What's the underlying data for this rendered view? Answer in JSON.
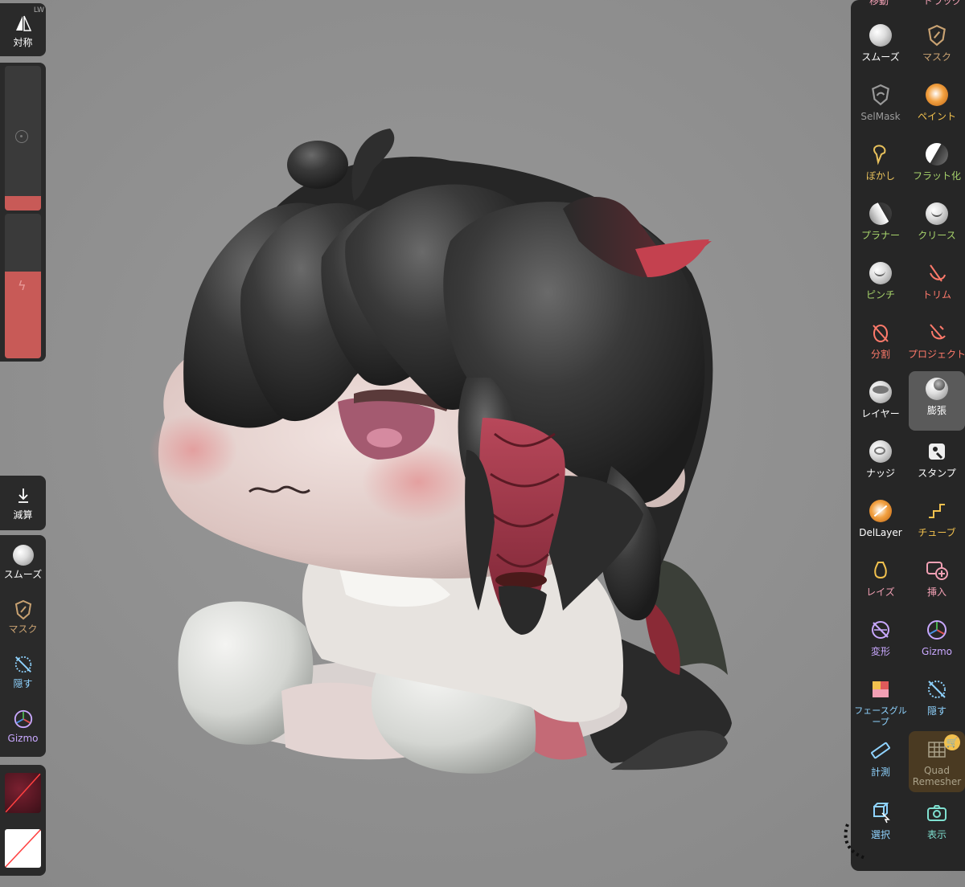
{
  "left_toolbar": {
    "symmetry": {
      "label": "対称",
      "corner": "LW"
    },
    "sliders": {
      "radius_fill": 0.1,
      "intensity_fill": 0.6
    },
    "subtract": {
      "label": "減算"
    },
    "quick_tools": [
      {
        "label": "スムーズ",
        "icon": "smooth-icon"
      },
      {
        "label": "マスク",
        "icon": "mask-icon"
      },
      {
        "label": "隠す",
        "icon": "hide-icon"
      },
      {
        "label": "Gizmo",
        "icon": "gizmo-icon"
      }
    ]
  },
  "right_toolbar": {
    "top_cut_labels": [
      "移動",
      "ドラッグ"
    ],
    "tools": [
      {
        "label": "スムーズ",
        "icon": "smooth-icon",
        "color": "#ffffff"
      },
      {
        "label": "マスク",
        "icon": "mask-icon",
        "color": "#c9a272"
      },
      {
        "label": "SelMask",
        "icon": "selmask-icon",
        "color": "#9a9a9a"
      },
      {
        "label": "ペイント",
        "icon": "paint-icon",
        "color": "#f2c14e"
      },
      {
        "label": "ぼかし",
        "icon": "blur-icon",
        "color": "#e8c15c"
      },
      {
        "label": "フラット化",
        "icon": "flatten-icon",
        "color": "#a7d36b"
      },
      {
        "label": "プラナー",
        "icon": "planar-icon",
        "color": "#a7d36b"
      },
      {
        "label": "クリース",
        "icon": "crease-icon",
        "color": "#a7d36b"
      },
      {
        "label": "ピンチ",
        "icon": "pinch-icon",
        "color": "#a7d36b"
      },
      {
        "label": "トリム",
        "icon": "trim-icon",
        "color": "#ff7a6b"
      },
      {
        "label": "分割",
        "icon": "split-icon",
        "color": "#ff7a6b"
      },
      {
        "label": "プロジェクト",
        "icon": "project-icon",
        "color": "#ff7a6b"
      },
      {
        "label": "レイヤー",
        "icon": "layer-icon",
        "color": "#ffffff"
      },
      {
        "label": "膨張",
        "icon": "inflate-icon",
        "color": "#ffffff",
        "selected": true
      },
      {
        "label": "ナッジ",
        "icon": "nudge-icon",
        "color": "#ffffff"
      },
      {
        "label": "スタンプ",
        "icon": "stamp-icon",
        "color": "#ffffff"
      },
      {
        "label": "DelLayer",
        "icon": "dellayer-icon",
        "color": "#ffffff"
      },
      {
        "label": "チューブ",
        "icon": "tube-icon",
        "color": "#f2c14e"
      },
      {
        "label": "レイズ",
        "icon": "lathe-icon",
        "color": "#f2a0b4"
      },
      {
        "label": "挿入",
        "icon": "insert-icon",
        "color": "#f2a0b4"
      },
      {
        "label": "変形",
        "icon": "transform-icon",
        "color": "#c9a8ff"
      },
      {
        "label": "Gizmo",
        "icon": "gizmo-icon",
        "color": "#c9a8ff"
      },
      {
        "label": "フェースグループ",
        "icon": "facegroup-icon",
        "color": "#8fd3ff"
      },
      {
        "label": "隠す",
        "icon": "hide-icon",
        "color": "#8fd3ff"
      },
      {
        "label": "計測",
        "icon": "measure-icon",
        "color": "#8fd3ff"
      },
      {
        "label": "Quad Remesher",
        "icon": "quad-remesher-icon",
        "color": "#aaa28a",
        "locked": true
      },
      {
        "label": "選択",
        "icon": "select-icon",
        "color": "#8fd3ff"
      },
      {
        "label": "表示",
        "icon": "view-icon",
        "color": "#7fe0d0"
      }
    ]
  },
  "colors": {
    "accent": "#c85a57",
    "panel": "#2a2a2a",
    "viewport": "#8f8f8f"
  }
}
